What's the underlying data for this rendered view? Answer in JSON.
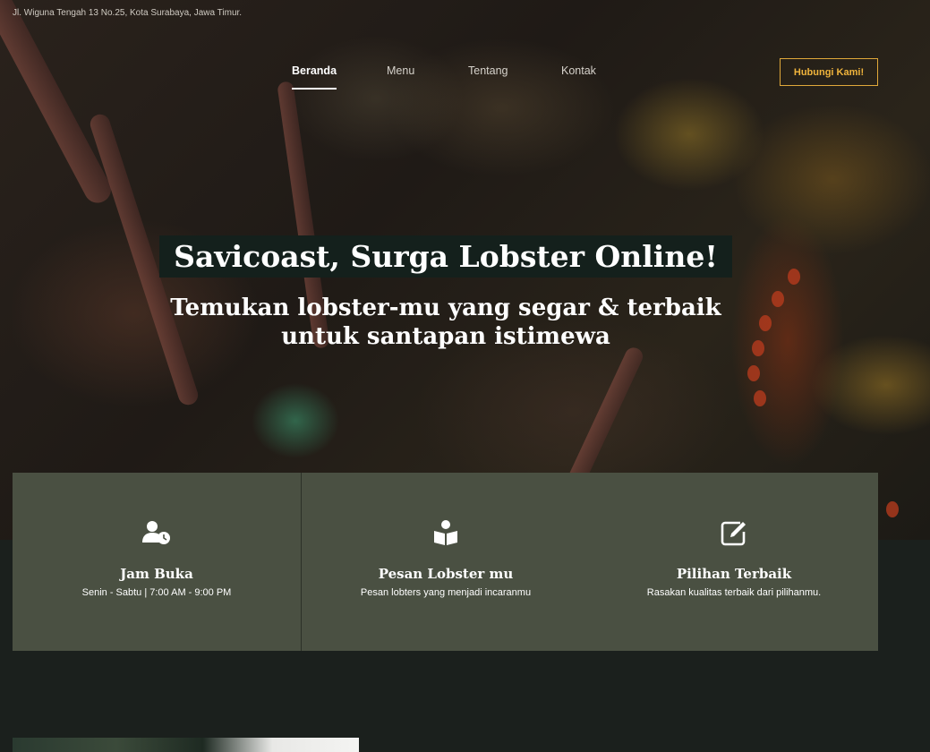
{
  "topbar": {
    "address": "Jl. Wiguna Tengah 13 No.25, Kota Surabaya, Jawa Timur."
  },
  "nav": {
    "items": [
      {
        "label": "Beranda",
        "active": true
      },
      {
        "label": "Menu",
        "active": false
      },
      {
        "label": "Tentang",
        "active": false
      },
      {
        "label": "Kontak",
        "active": false
      }
    ],
    "cta_label": "Hubungi Kami!"
  },
  "hero": {
    "title": "Savicoast, Surga Lobster Online!",
    "subtitle_line1": "Temukan lobster-mu yang segar & terbaik",
    "subtitle_line2": "untuk santapan istimewa"
  },
  "features": [
    {
      "icon": "user-clock-icon",
      "title": "Jam Buka",
      "text": "Senin - Sabtu | 7:00 AM - 9:00 PM"
    },
    {
      "icon": "book-reader-icon",
      "title": "Pesan Lobster mu",
      "text": "Pesan lobters yang menjadi incaranmu"
    },
    {
      "icon": "edit-icon",
      "title": "Pilihan Terbaik",
      "text": "Rasakan kualitas terbaik dari pilihanmu."
    }
  ],
  "colors": {
    "accent": "#f0b43c",
    "feature_bg": "#4a5042",
    "page_bg": "#1b201d"
  }
}
